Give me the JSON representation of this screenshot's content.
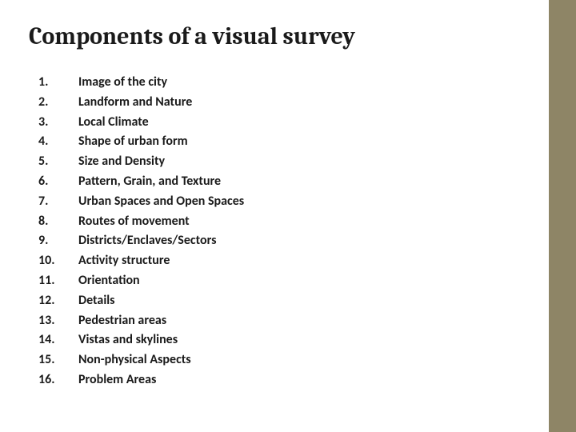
{
  "title": "Components of a visual survey",
  "items": [
    "Image of the city",
    "Landform and Nature",
    "Local Climate",
    "Shape of urban form",
    "Size and Density",
    "Pattern, Grain, and Texture",
    "Urban Spaces and Open Spaces",
    "Routes of movement",
    "Districts/Enclaves/Sectors",
    "Activity structure",
    "Orientation",
    "Details",
    "Pedestrian areas",
    "Vistas and skylines",
    "Non-physical Aspects",
    "Problem Areas"
  ]
}
